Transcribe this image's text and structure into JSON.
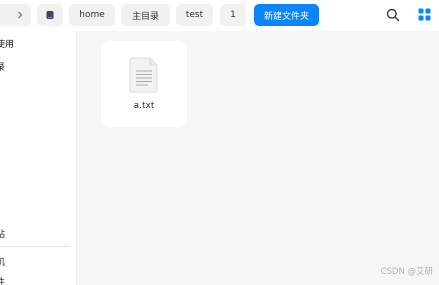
{
  "toolbar": {
    "back_label": "<",
    "breadcrumbs": [
      {
        "label": "home"
      },
      {
        "label": "主目录"
      },
      {
        "label": "test"
      },
      {
        "label": "1"
      }
    ],
    "new_folder_label": "新建文件夹",
    "accent_color": "#0a84ff"
  },
  "sidebar": {
    "items": [
      {
        "label": "使用"
      },
      {
        "label": "录"
      },
      {
        "label": "站"
      },
      {
        "label": "机"
      },
      {
        "label": "件"
      }
    ]
  },
  "files": [
    {
      "name": "a.txt",
      "icon": "text-file-icon"
    }
  ],
  "watermark": "CSDN @艾研"
}
